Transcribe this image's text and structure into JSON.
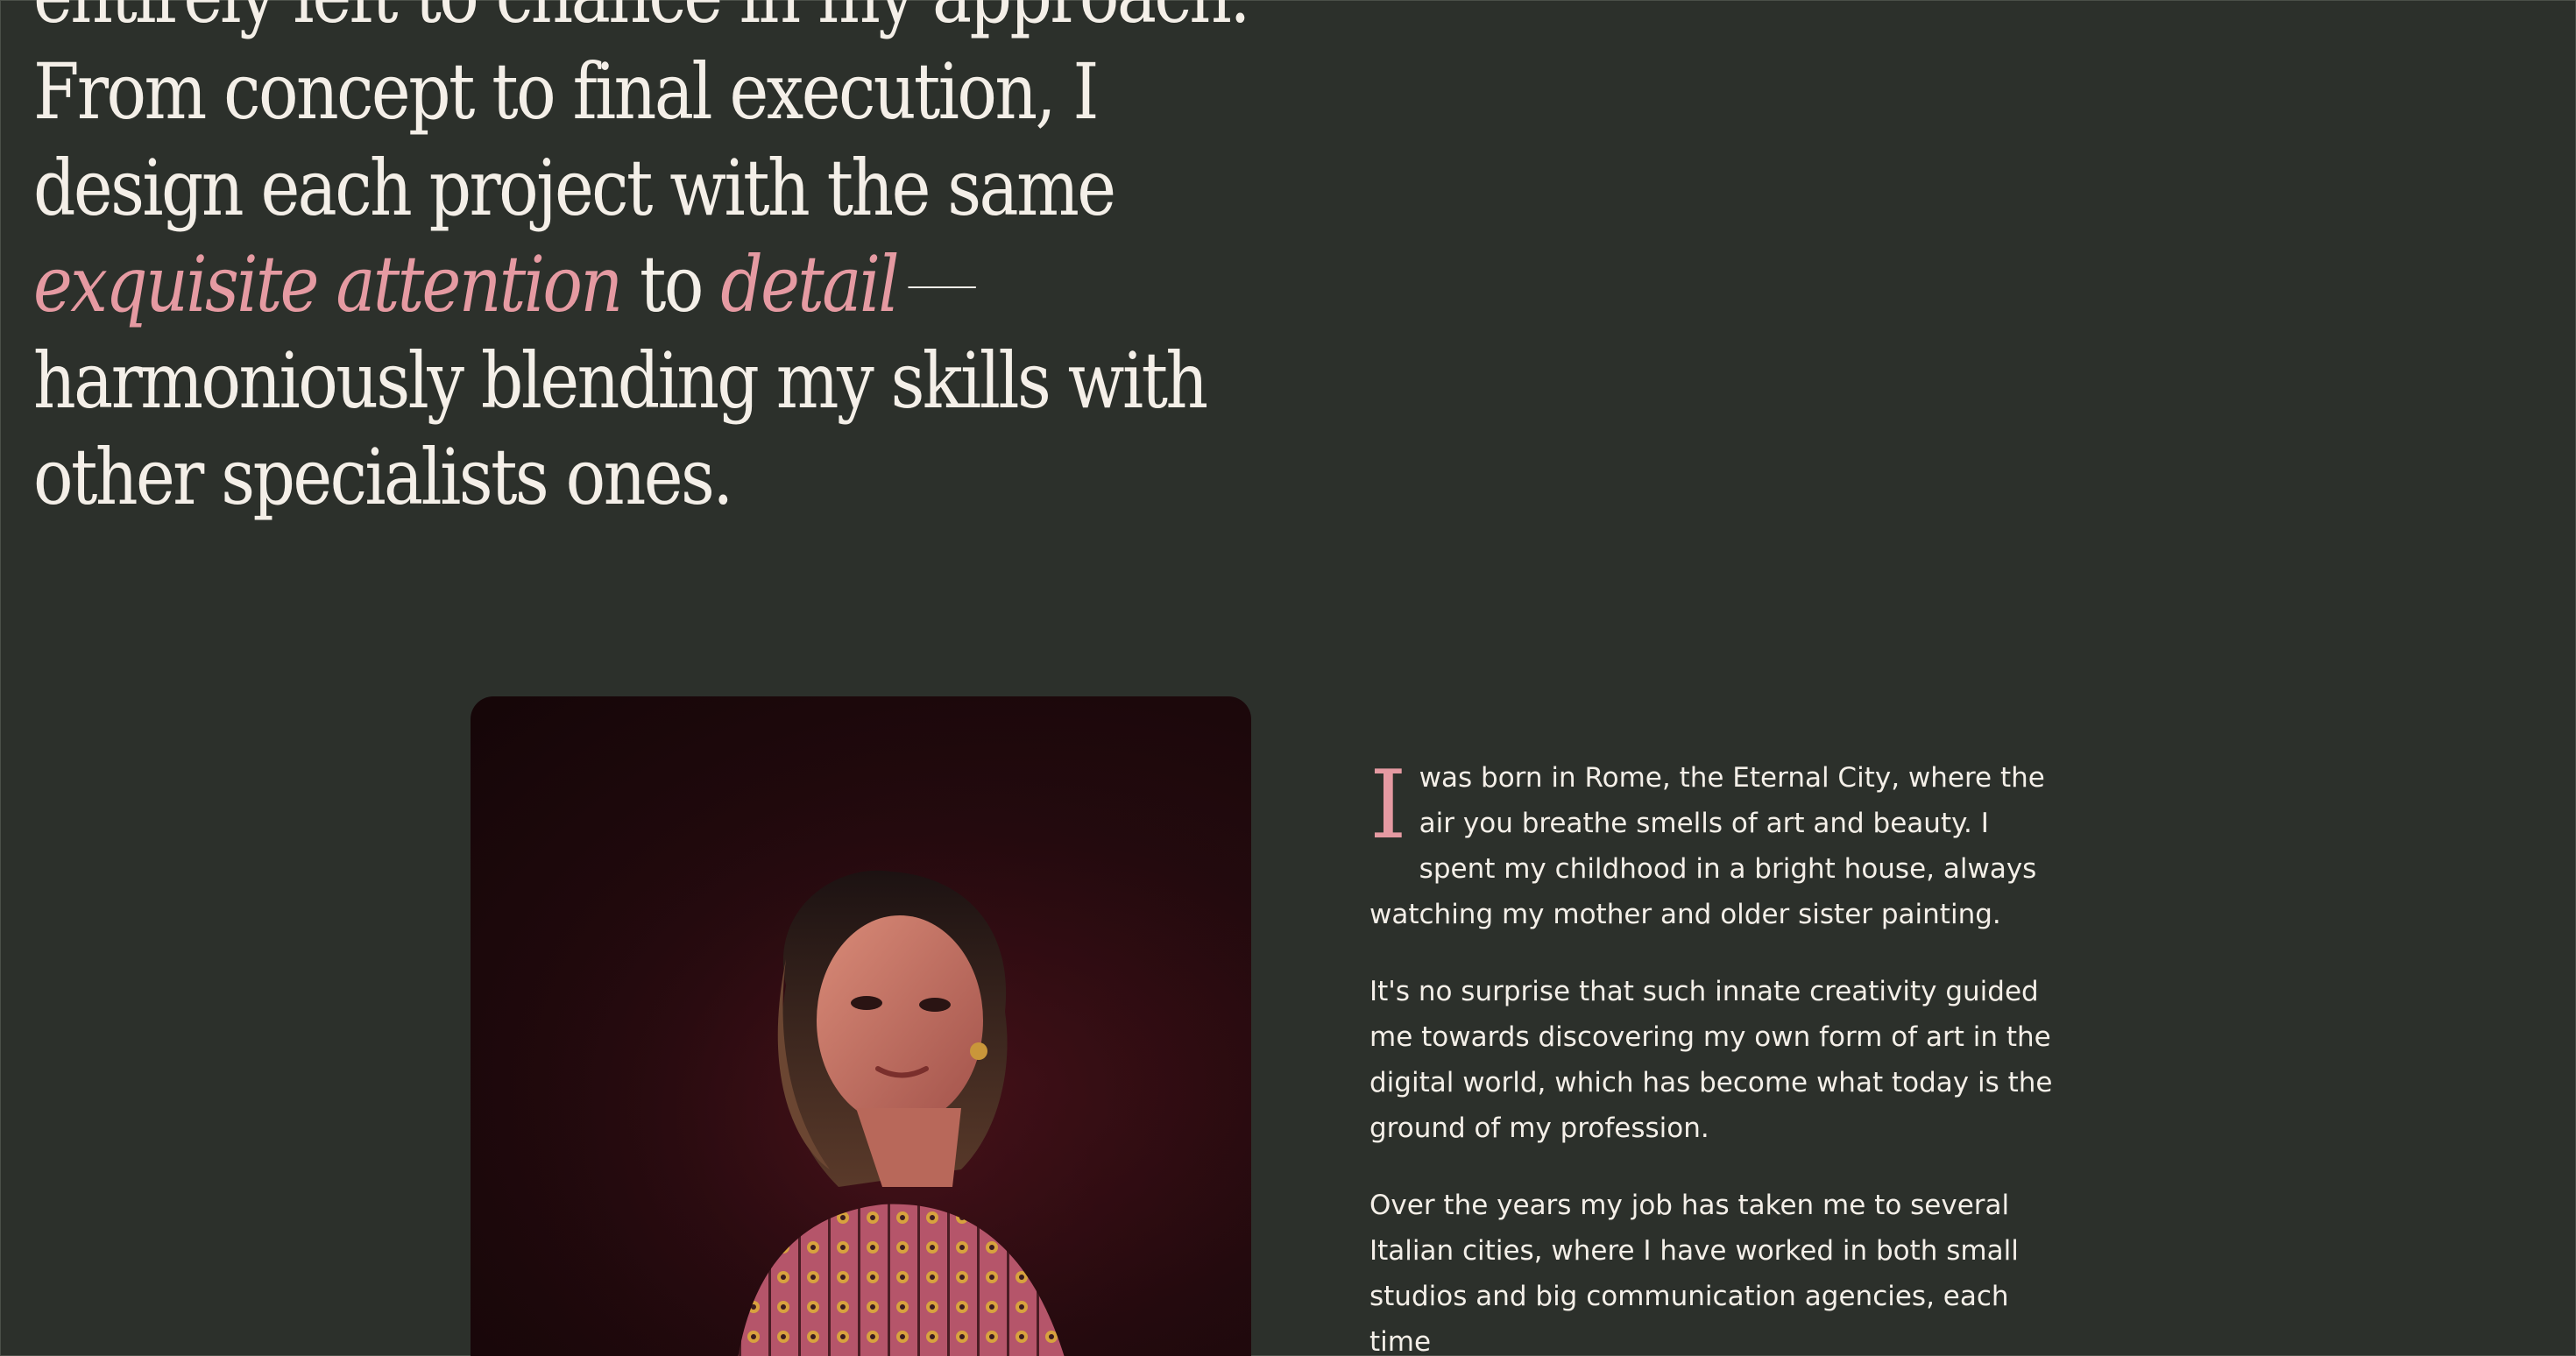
{
  "headline": {
    "line0": "entirely left to chance in my approach.",
    "line1": "From concept to final execution, I",
    "line2": "design each project with the same",
    "line3_accent1": "exquisite attention",
    "line3_plain": "to",
    "line3_accent2": "detail",
    "line4": "harmoniously blending my skills with",
    "line5": "other specialists ones."
  },
  "portrait": {
    "icon": "portrait-photo"
  },
  "bio": {
    "dropcap": "I",
    "p1_rest": " was born in Rome, the Eternal City, where the air you breathe smells of art and beauty. I spent my childhood in a bright house, always watching my mother and older sister painting.",
    "p2": "It's no surprise that such innate creativity guided me towards discovering my own form of art in the digital world, which has become what today is the ground of my profession.",
    "p3": "Over the years my job has taken me to several Italian cities, where I have worked in both small studios and big communication agencies, each time"
  },
  "colors": {
    "background": "#2c302b",
    "text": "#f4efe8",
    "accent": "#e59aa2"
  }
}
